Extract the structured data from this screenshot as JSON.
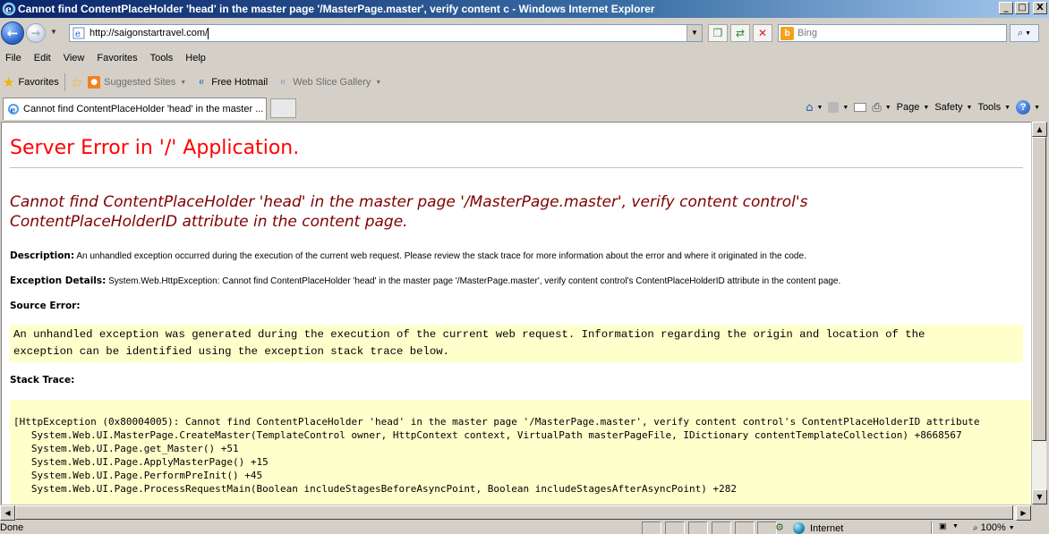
{
  "window": {
    "title": "Cannot find ContentPlaceHolder 'head' in the master page '/MasterPage.master', verify content c - Windows Internet Explorer",
    "buttons": {
      "minimize": "_",
      "maximize": "□",
      "close": "X"
    }
  },
  "navigation": {
    "address": "http://saigonstartravel.com/",
    "search_placeholder": "Bing"
  },
  "menu": [
    "File",
    "Edit",
    "View",
    "Favorites",
    "Tools",
    "Help"
  ],
  "favorites_bar": {
    "favorites_label": "Favorites",
    "links": [
      "Suggested Sites",
      "Free Hotmail",
      "Web Slice Gallery"
    ]
  },
  "tab": {
    "title": "Cannot find ContentPlaceHolder 'head' in the master ..."
  },
  "command_bar": {
    "page": "Page",
    "safety": "Safety",
    "tools": "Tools"
  },
  "page": {
    "heading": "Server Error in '/' Application.",
    "error_title": "Cannot find ContentPlaceHolder 'head' in the master page '/MasterPage.master', verify content control's ContentPlaceHolderID attribute in the content page.",
    "description_label": "Description:",
    "description_text": "An unhandled exception occurred during the execution of the current web request. Please review the stack trace for more information about the error and where it originated in the code.",
    "exception_label": "Exception Details:",
    "exception_text": "System.Web.HttpException: Cannot find ContentPlaceHolder 'head' in the master page '/MasterPage.master', verify content control's ContentPlaceHolderID attribute in the content page.",
    "source_error_label": "Source Error:",
    "source_error_text": "An unhandled exception was generated during the execution of the current web request. Information regarding the origin and location of the\nexception can be identified using the exception stack trace below.",
    "stack_trace_label": "Stack Trace:",
    "stack_trace_text": "[HttpException (0x80004005): Cannot find ContentPlaceHolder 'head' in the master page '/MasterPage.master', verify content control's ContentPlaceHolderID attribute\n   System.Web.UI.MasterPage.CreateMaster(TemplateControl owner, HttpContext context, VirtualPath masterPageFile, IDictionary contentTemplateCollection) +8668567\n   System.Web.UI.Page.get_Master() +51\n   System.Web.UI.Page.ApplyMasterPage() +15\n   System.Web.UI.Page.PerformPreInit() +45\n   System.Web.UI.Page.ProcessRequestMain(Boolean includeStagesBeforeAsyncPoint, Boolean includeStagesAfterAsyncPoint) +282"
  },
  "status_bar": {
    "status": "Done",
    "zone": "Internet",
    "zoom": "100%"
  }
}
